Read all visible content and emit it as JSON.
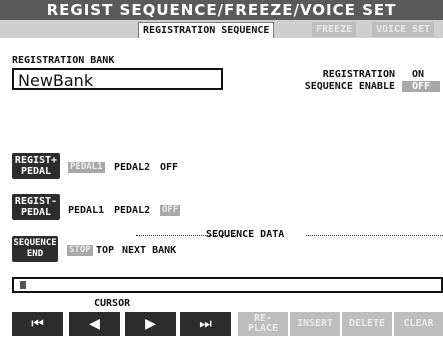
{
  "title": "REGIST SEQUENCE/FREEZE/VOICE SET",
  "tabs": [
    {
      "label": "REGISTRATION SEQUENCE",
      "active": true
    },
    {
      "label": "FREEZE",
      "active": false
    },
    {
      "label": "VOICE SET",
      "active": false
    }
  ],
  "registration_bank": {
    "label": "REGISTRATION BANK",
    "value": "NewBank"
  },
  "sequence_enable": {
    "label_line1": "REGISTRATION",
    "label_line2": "SEQUENCE ENABLE",
    "option_on": "ON",
    "option_off": "OFF",
    "selected": "OFF"
  },
  "regist_plus": {
    "button_line1": "REGIST+",
    "button_line2": "PEDAL",
    "pedal1": "PEDAL1",
    "pedal2": "PEDAL2",
    "off": "OFF",
    "selected": "PEDAL1"
  },
  "regist_minus": {
    "button_line1": "REGIST-",
    "button_line2": "PEDAL",
    "pedal1": "PEDAL1",
    "pedal2": "PEDAL2",
    "off": "OFF",
    "selected": "OFF"
  },
  "sequence_data": {
    "header": "SEQUENCE DATA"
  },
  "sequence_end": {
    "button_line1": "SEQUENCE",
    "button_line2": "END",
    "stop": "STOP",
    "top": "TOP",
    "next_bank": "NEXT BANK",
    "selected": "STOP"
  },
  "cursor": {
    "label": "CURSOR",
    "first": "⏮",
    "prev": "◀",
    "next": "▶",
    "last": "⏭"
  },
  "actions": {
    "replace_line1": "RE-",
    "replace_line2": "PLACE",
    "insert": "INSERT",
    "delete": "DELETE",
    "clear": "CLEAR"
  }
}
